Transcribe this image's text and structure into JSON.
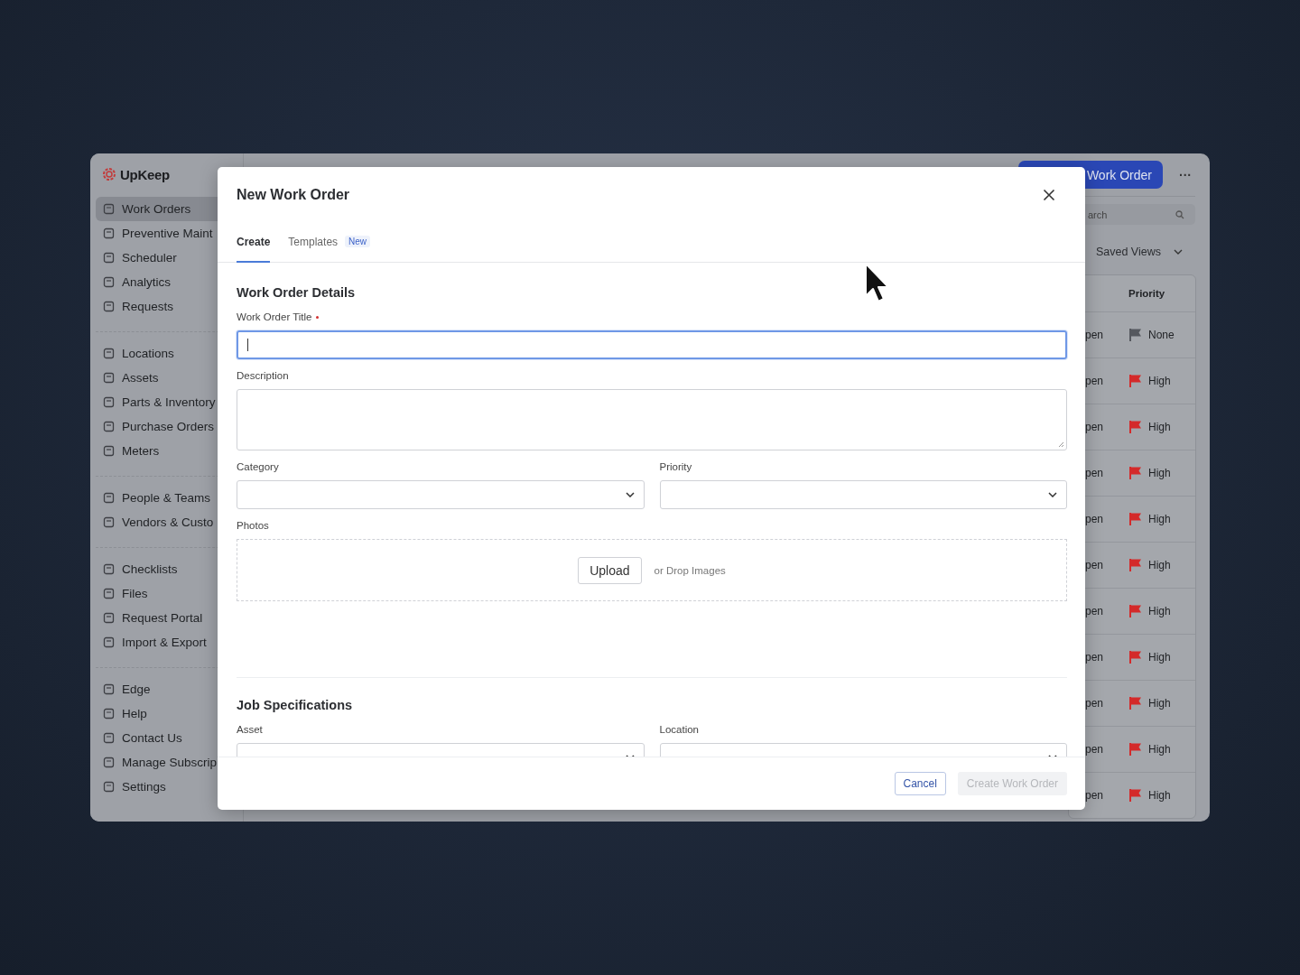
{
  "app": {
    "logo": "UpKeep",
    "sidebar": [
      [
        {
          "label": "Work Orders",
          "selected": true
        },
        {
          "label": "Preventive Maint",
          "selected": false
        },
        {
          "label": "Scheduler",
          "selected": false
        },
        {
          "label": "Analytics",
          "selected": false
        },
        {
          "label": "Requests",
          "selected": false
        }
      ],
      [
        {
          "label": "Locations",
          "selected": false
        },
        {
          "label": "Assets",
          "selected": false
        },
        {
          "label": "Parts & Inventory",
          "selected": false
        },
        {
          "label": "Purchase Orders",
          "selected": false
        },
        {
          "label": "Meters",
          "selected": false
        }
      ],
      [
        {
          "label": "People & Teams",
          "selected": false
        },
        {
          "label": "Vendors & Custo",
          "selected": false
        }
      ],
      [
        {
          "label": "Checklists",
          "selected": false
        },
        {
          "label": "Files",
          "selected": false
        },
        {
          "label": "Request Portal",
          "selected": false
        },
        {
          "label": "Import & Export",
          "selected": false
        }
      ],
      [
        {
          "label": "Edge",
          "selected": false
        },
        {
          "label": "Help",
          "selected": false
        },
        {
          "label": "Contact Us",
          "selected": false
        },
        {
          "label": "Manage Subscrip",
          "selected": false
        },
        {
          "label": "Settings",
          "selected": false
        }
      ]
    ],
    "new_button": "Work Order",
    "more_button": "···",
    "search": {
      "placeholder": "arch"
    },
    "saved_views": "Saved Views",
    "table": {
      "columns": [
        "Priority"
      ],
      "rows": [
        {
          "status": "pen",
          "priority": "None",
          "color": "#55585e"
        },
        {
          "status": "pen",
          "priority": "High",
          "color": "#d42a2a"
        },
        {
          "status": "pen",
          "priority": "High",
          "color": "#d42a2a"
        },
        {
          "status": "pen",
          "priority": "High",
          "color": "#d42a2a"
        },
        {
          "status": "pen",
          "priority": "High",
          "color": "#d42a2a"
        },
        {
          "status": "pen",
          "priority": "High",
          "color": "#d42a2a"
        },
        {
          "status": "pen",
          "priority": "High",
          "color": "#d42a2a"
        },
        {
          "status": "pen",
          "priority": "High",
          "color": "#d42a2a"
        },
        {
          "status": "pen",
          "priority": "High",
          "color": "#d42a2a"
        },
        {
          "status": "pen",
          "priority": "High",
          "color": "#d42a2a"
        },
        {
          "status": "pen",
          "priority": "High",
          "color": "#d42a2a"
        }
      ]
    }
  },
  "modal": {
    "title": "New Work Order",
    "tabs": [
      {
        "label": "Create",
        "selected": true
      },
      {
        "label": "Templates",
        "badge": "New",
        "selected": false
      }
    ],
    "sections": [
      {
        "heading": "Work Order Details",
        "rows": [
          [
            {
              "kind": "text",
              "label": "Work Order Title",
              "required": true,
              "focused": true
            }
          ],
          [
            {
              "kind": "textarea",
              "label": "Description"
            }
          ],
          [
            {
              "kind": "select",
              "label": "Category"
            },
            {
              "kind": "select",
              "label": "Priority"
            }
          ],
          [
            {
              "kind": "upload",
              "label": "Photos",
              "button": "Upload",
              "hint": "or Drop Images"
            }
          ]
        ]
      },
      {
        "heading": "Job Specifications",
        "rows": [
          [
            {
              "kind": "select",
              "label": "Asset"
            },
            {
              "kind": "select",
              "label": "Location"
            }
          ]
        ]
      }
    ],
    "cancel": "Cancel",
    "submit": {
      "label": "Create Work Order",
      "disabled": true
    }
  }
}
